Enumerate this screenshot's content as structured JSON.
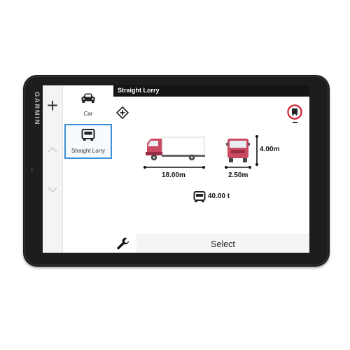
{
  "device": {
    "brand": "GARMIN"
  },
  "profiles": [
    {
      "label": "Car",
      "icon": "car-icon",
      "selected": false
    },
    {
      "label": "Straight Lorry",
      "icon": "lorry-icon",
      "selected": true
    }
  ],
  "header": {
    "title": "Straight Lorry"
  },
  "dimensions": {
    "length": "18.00m",
    "width": "2.50m",
    "height": "4.00m",
    "weight": "40.00 t"
  },
  "footer": {
    "select_label": "Select"
  },
  "colors": {
    "accent": "#3d8fd6",
    "truck": "#c94a60",
    "header_bg": "#141414",
    "sign_red": "#d2202f"
  }
}
